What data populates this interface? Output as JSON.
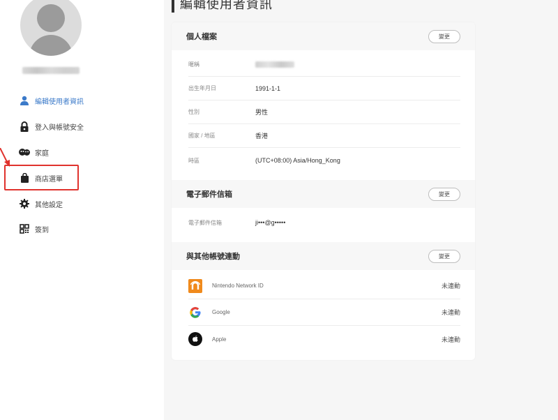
{
  "page": {
    "title": "編輯使用者資訊"
  },
  "sidebar": {
    "items": [
      {
        "label": "編輯使用者資訊",
        "icon": "user-icon",
        "active": true
      },
      {
        "label": "登入與帳號安全",
        "icon": "lock-icon",
        "active": false
      },
      {
        "label": "家庭",
        "icon": "family-icon",
        "active": false
      },
      {
        "label": "商店選單",
        "icon": "shopping-bag-icon",
        "active": false
      },
      {
        "label": "其他設定",
        "icon": "gear-icon",
        "active": false
      },
      {
        "label": "簽到",
        "icon": "qr-code-icon",
        "active": false
      }
    ]
  },
  "profile": {
    "title": "個人檔案",
    "change_label": "變更",
    "fields": [
      {
        "label": "暱稱",
        "value": ""
      },
      {
        "label": "出生年月日",
        "value": "1991-1-1"
      },
      {
        "label": "性別",
        "value": "男性"
      },
      {
        "label": "國家 / 地區",
        "value": "香港"
      },
      {
        "label": "時區",
        "value": "(UTC+08:00) Asia/Hong_Kong"
      }
    ]
  },
  "email": {
    "title": "電子郵件信箱",
    "change_label": "變更",
    "field_label": "電子郵件信箱",
    "field_value": "ji•••@g•••••"
  },
  "linked": {
    "title": "與其他帳號連動",
    "change_label": "變更",
    "accounts": [
      {
        "name": "Nintendo Network ID",
        "status": "未連動",
        "icon": "nintendo-network-icon"
      },
      {
        "name": "Google",
        "status": "未連動",
        "icon": "google-icon"
      },
      {
        "name": "Apple",
        "status": "未連動",
        "icon": "apple-icon"
      }
    ]
  },
  "colors": {
    "accent": "#3b7ac9",
    "highlight": "#e0322d",
    "nnid": "#f08a1c"
  }
}
